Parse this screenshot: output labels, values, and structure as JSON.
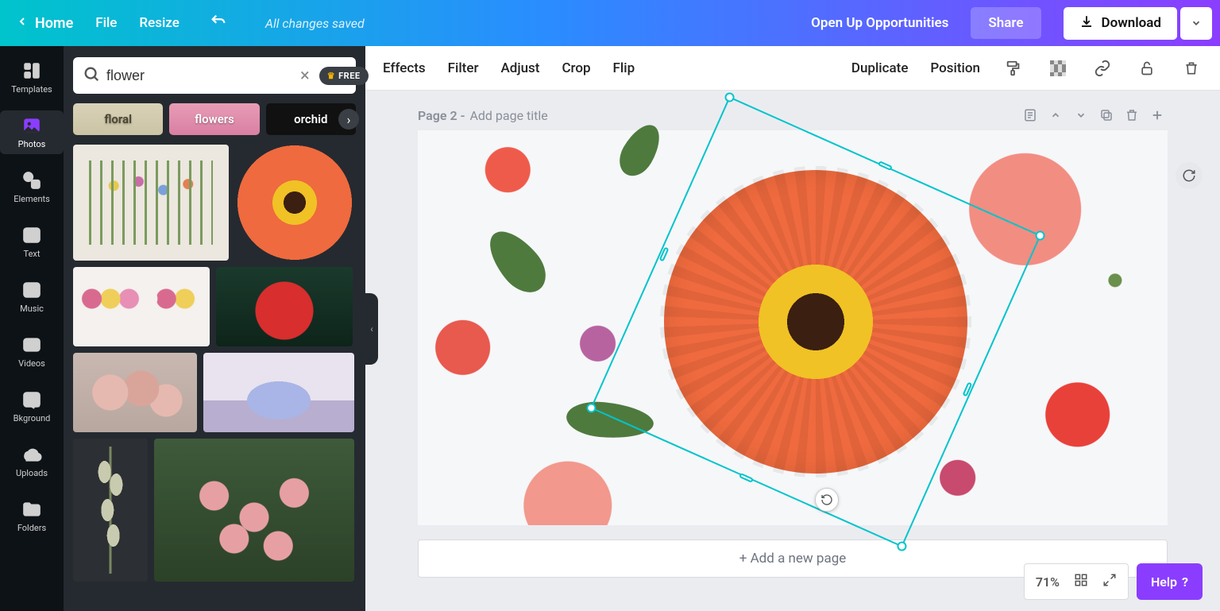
{
  "topbar": {
    "home": "Home",
    "file": "File",
    "resize": "Resize",
    "save_status": "All changes saved",
    "opportunity": "Open Up Opportunities",
    "share": "Share",
    "download": "Download"
  },
  "rail": {
    "templates": "Templates",
    "photos": "Photos",
    "elements": "Elements",
    "text": "Text",
    "music": "Music",
    "videos": "Videos",
    "bkground": "Bkground",
    "uploads": "Uploads",
    "folders": "Folders"
  },
  "panel": {
    "search_value": "flower",
    "free_badge": "FREE",
    "chips": [
      "floral",
      "flowers",
      "orchid"
    ]
  },
  "context": {
    "effects": "Effects",
    "filter": "Filter",
    "adjust": "Adjust",
    "crop": "Crop",
    "flip": "Flip",
    "duplicate": "Duplicate",
    "position": "Position"
  },
  "page": {
    "label_prefix": "Page 2 - ",
    "title_placeholder": "Add page title"
  },
  "add_page": "+ Add a new page",
  "zoom": {
    "percent": "71%"
  },
  "help": "Help"
}
